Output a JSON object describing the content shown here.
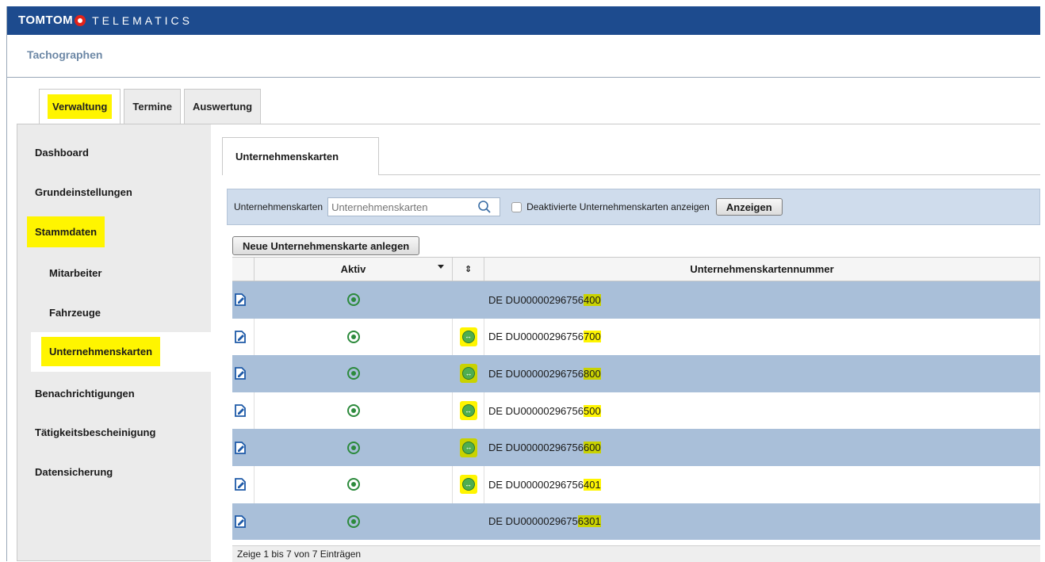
{
  "header": {
    "brand": "TOMTOM",
    "brand_sub": "TELEMATICS"
  },
  "page_title": "Tachographen",
  "main_tabs": [
    {
      "label": "Verwaltung"
    },
    {
      "label": "Termine"
    },
    {
      "label": "Auswertung"
    }
  ],
  "sidebar": {
    "items": [
      {
        "label": "Dashboard"
      },
      {
        "label": "Grundeinstellungen"
      },
      {
        "label": "Stammdaten"
      },
      {
        "label": "Mitarbeiter"
      },
      {
        "label": "Fahrzeuge"
      },
      {
        "label": "Unternehmenskarten"
      },
      {
        "label": "Benachrichtigungen"
      },
      {
        "label": "Tätigkeitsbescheinigung"
      },
      {
        "label": "Datensicherung"
      }
    ]
  },
  "subtab": {
    "label": "Unternehmenskarten"
  },
  "filter": {
    "label": "Unternehmenskarten",
    "placeholder": "Unternehmenskarten",
    "checkbox_label": "Deaktivierte Unternehmenskarten anzeigen",
    "button": "Anzeigen"
  },
  "new_button": "Neue Unternehmenskarte anlegen",
  "table": {
    "columns": [
      "Aktiv",
      "Unternehmenskartennummer"
    ],
    "rows": [
      {
        "prefix": "DE DU00000296756",
        "suffix": "400",
        "sync": false
      },
      {
        "prefix": "DE DU00000296756",
        "suffix": "700",
        "sync": true
      },
      {
        "prefix": "DE DU00000296756",
        "suffix": "800",
        "sync": true
      },
      {
        "prefix": "DE DU00000296756",
        "suffix": "500",
        "sync": true
      },
      {
        "prefix": "DE DU00000296756",
        "suffix": "600",
        "sync": true
      },
      {
        "prefix": "DE DU00000296756",
        "suffix": "401",
        "sync": true
      },
      {
        "prefix": "DE DU0000029675",
        "suffix": "6301",
        "sync": false
      }
    ]
  },
  "footer": "Zeige 1 bis 7 von 7 Einträgen",
  "colors": {
    "header": "#1d4b8e",
    "row_alt": "#a9bfd9",
    "highlight": "#fff500",
    "active_green": "#2c8a3c"
  },
  "icons": {
    "edit": "edit-card-icon",
    "active": "active-radio-icon",
    "sync": "sync-icon",
    "search": "search-icon"
  }
}
